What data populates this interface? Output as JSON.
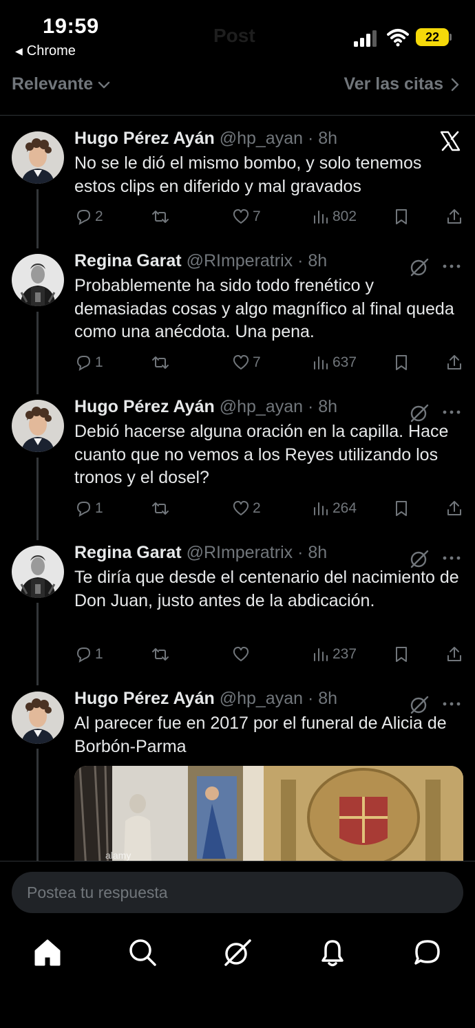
{
  "status": {
    "time": "19:59",
    "back_app": "Chrome",
    "faded_title": "Post",
    "battery": "22"
  },
  "sort": {
    "left_label": "Relevante",
    "right_label": "Ver las citas"
  },
  "tweets": [
    {
      "name": "Hugo Pérez Ayán",
      "handle": "@hp_ayan",
      "dot": "·",
      "ago": "8h",
      "text": "No se le dió el mismo bombo, y solo tenemos estos clips en diferido y mal gravados",
      "replies": "2",
      "reposts": "",
      "likes": "7",
      "views": "802"
    },
    {
      "name": "Regina Garat",
      "handle": "@RImperatrix",
      "dot": "·",
      "ago": "8h",
      "text": "Probablemente ha sido todo frenético y demasiadas cosas y algo magnífico al final queda como una anécdota. Una pena.",
      "replies": "1",
      "reposts": "",
      "likes": "7",
      "views": "637"
    },
    {
      "name": "Hugo Pérez Ayán",
      "handle": "@hp_ayan",
      "dot": "·",
      "ago": "8h",
      "text": "Debió hacerse alguna oración en la capilla. Hace cuanto que no vemos a los Reyes utilizando los tronos y el dosel?",
      "replies": "1",
      "reposts": "",
      "likes": "2",
      "views": "264"
    },
    {
      "name": "Regina Garat",
      "handle": "@RImperatrix",
      "dot": "·",
      "ago": "8h",
      "text": "Te diría que desde el centenario del nacimiento de Don Juan, justo antes de la abdicación.",
      "replies": "1",
      "reposts": "",
      "likes": "",
      "views": "237"
    },
    {
      "name": "Hugo Pérez Ayán",
      "handle": "@hp_ayan",
      "dot": "·",
      "ago": "8h",
      "text": "Al parecer fue en 2017 por el funeral de Alicia de Borbón-Parma",
      "media_watermark": "alamy"
    }
  ],
  "reply": {
    "placeholder": "Postea tu respuesta"
  },
  "icons": {
    "tabs": [
      "home-icon",
      "search-icon",
      "grok-icon",
      "notifications-icon",
      "messages-icon"
    ],
    "tweet_actions": [
      "reply-icon",
      "repost-icon",
      "like-icon",
      "views-icon",
      "bookmark-icon",
      "share-icon"
    ]
  },
  "colors": {
    "background": "#000000",
    "text": "#e7e9ea",
    "muted": "#71767b",
    "battery": "#f5d90a",
    "input_bg": "#202327"
  }
}
